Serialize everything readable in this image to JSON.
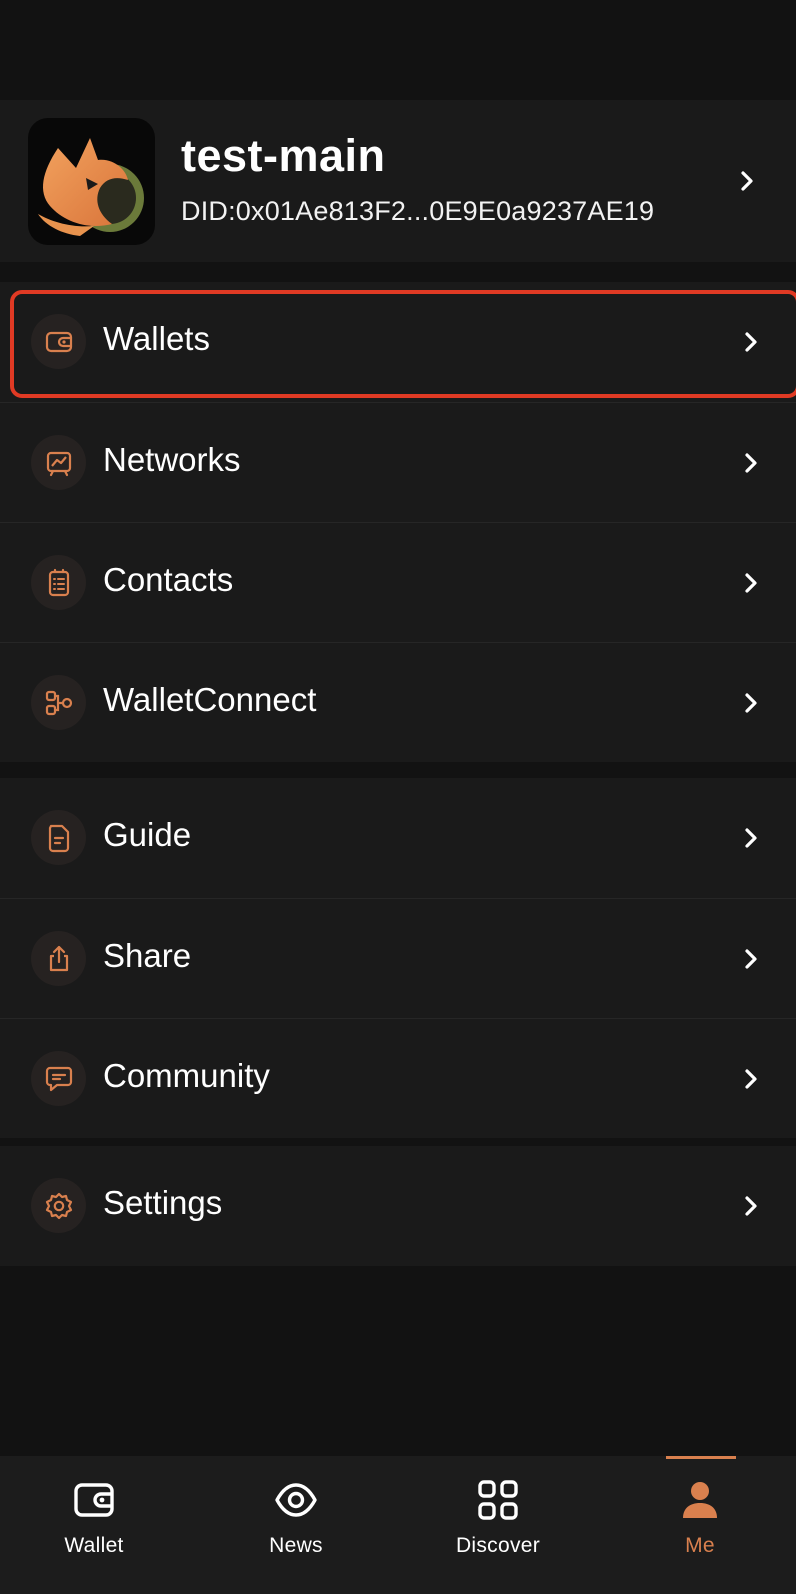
{
  "profile": {
    "name": "test-main",
    "did": "DID:0x01Ae813F2...0E9E0a9237AE19"
  },
  "menu_groups": [
    {
      "items": [
        {
          "label": "Wallets",
          "icon": "wallet-icon",
          "highlighted": true
        },
        {
          "label": "Networks",
          "icon": "network-chart-icon"
        },
        {
          "label": "Contacts",
          "icon": "contacts-list-icon"
        },
        {
          "label": "WalletConnect",
          "icon": "walletconnect-icon"
        }
      ]
    },
    {
      "items": [
        {
          "label": "Guide",
          "icon": "document-icon"
        },
        {
          "label": "Share",
          "icon": "share-icon"
        },
        {
          "label": "Community",
          "icon": "chat-bubble-icon"
        }
      ]
    },
    {
      "items": [
        {
          "label": "Settings",
          "icon": "gear-icon"
        }
      ]
    }
  ],
  "tabbar": {
    "tabs": [
      {
        "label": "Wallet",
        "icon": "wallet-icon"
      },
      {
        "label": "News",
        "icon": "eye-icon"
      },
      {
        "label": "Discover",
        "icon": "grid-icon"
      },
      {
        "label": "Me",
        "icon": "person-icon",
        "active": true
      }
    ]
  },
  "colors": {
    "accent": "#d9804e",
    "highlight_border": "#e03a24",
    "background": "#121212",
    "surface": "#1a1a1a"
  }
}
